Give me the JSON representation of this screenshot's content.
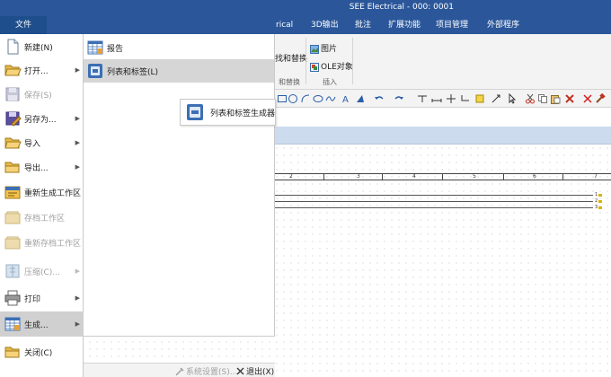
{
  "window": {
    "title": "SEE Electrical - 000: 0001"
  },
  "tabs": {
    "file": "文件",
    "partial_tab": "rical",
    "items": [
      "3D输出",
      "批注",
      "扩展功能",
      "项目管理",
      "外部程序"
    ]
  },
  "ribbon": {
    "find_replace": "找和替换",
    "find_replace_group": "和替换",
    "picture": "图片",
    "ole_object": "OLE对象",
    "insert_group": "插入"
  },
  "file_menu": {
    "items": [
      {
        "label": "新建(N)",
        "icon": "new-document-icon",
        "arrow": false,
        "disabled": false
      },
      {
        "label": "打开...",
        "icon": "open-folder-icon",
        "arrow": true,
        "disabled": false
      },
      {
        "label": "保存(S)",
        "icon": "save-icon",
        "arrow": false,
        "disabled": true
      },
      {
        "label": "另存为...",
        "icon": "save-as-icon",
        "arrow": true,
        "disabled": false
      },
      {
        "label": "导入",
        "icon": "import-folder-icon",
        "arrow": true,
        "disabled": false
      },
      {
        "label": "导出...",
        "icon": "export-folder-icon",
        "arrow": true,
        "disabled": false
      },
      {
        "label": "重新生成工作区",
        "icon": "regenerate-workspace-icon",
        "arrow": false,
        "disabled": false
      },
      {
        "label": "存档工作区",
        "icon": "archive-workspace-icon",
        "arrow": false,
        "disabled": true
      },
      {
        "label": "重新存档工作区",
        "icon": "rearchive-workspace-icon",
        "arrow": false,
        "disabled": true
      },
      {
        "label": "压缩(C)...",
        "icon": "compress-icon",
        "arrow": true,
        "disabled": true
      },
      {
        "label": "打印",
        "icon": "printer-icon",
        "arrow": true,
        "disabled": false
      },
      {
        "label": "生成...",
        "icon": "generate-icon",
        "arrow": true,
        "disabled": false,
        "active": true
      },
      {
        "label": "关闭(C)",
        "icon": "close-folder-icon",
        "arrow": false,
        "disabled": false
      }
    ]
  },
  "submenu": {
    "items": [
      {
        "label": "报告",
        "icon": "report-icon"
      },
      {
        "label": "列表和标签(L)",
        "icon": "list-label-icon",
        "active": true
      }
    ]
  },
  "flyout": {
    "label": "列表和标签生成器",
    "icon": "list-label-generator-icon"
  },
  "bottom": {
    "settings": "系统设置(S)...",
    "exit": "退出(X)"
  },
  "drawing": {
    "ruler_numbers": [
      "2",
      "3",
      "4",
      "5",
      "6",
      "7"
    ],
    "wire_labels": [
      "1",
      "2",
      "3"
    ]
  },
  "colors": {
    "titlebar": "#2b579a",
    "menu_active": "#d0d0d0",
    "strip": "#cddbee"
  }
}
